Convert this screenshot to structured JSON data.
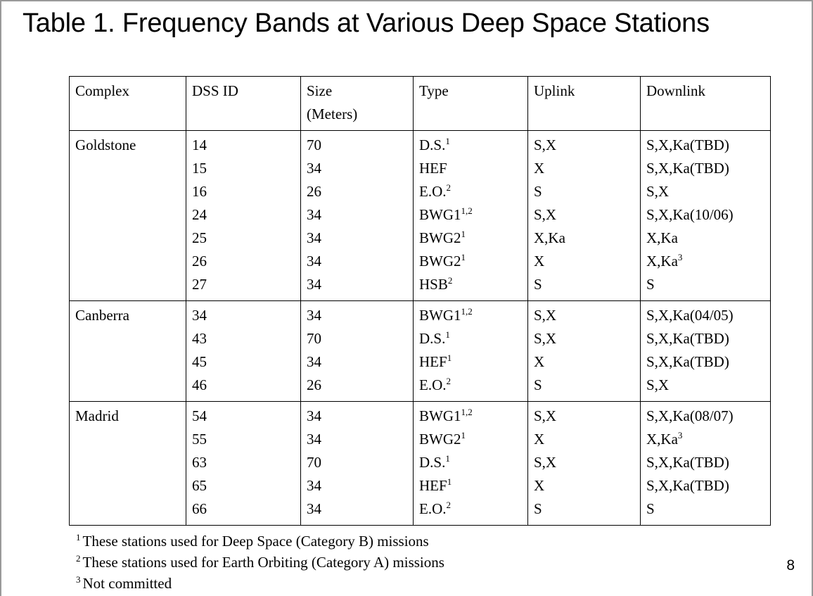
{
  "slide": {
    "title": "Table 1. Frequency Bands at Various Deep Space Stations",
    "page_number": "8",
    "border_color": "#9a9a9a",
    "text_color": "#000000",
    "background_color": "#ffffff"
  },
  "table": {
    "headers": {
      "complex": "Complex",
      "dss_id": "DSS ID",
      "size_line1": "Size",
      "size_line2": "(Meters)",
      "type": "Type",
      "uplink": "Uplink",
      "downlink": "Downlink"
    },
    "groups": [
      {
        "complex": "Goldstone",
        "rows": [
          {
            "dss_id": "14",
            "size": "70",
            "type": "D.S.",
            "type_sup": "1",
            "uplink": "S,X",
            "downlink": "S,X,Ka(TBD)",
            "downlink_sup": ""
          },
          {
            "dss_id": "15",
            "size": "34",
            "type": "HEF",
            "type_sup": "",
            "uplink": "X",
            "downlink": "S,X,Ka(TBD)",
            "downlink_sup": ""
          },
          {
            "dss_id": "16",
            "size": "26",
            "type": "E.O.",
            "type_sup": "2",
            "uplink": "S",
            "downlink": "S,X",
            "downlink_sup": ""
          },
          {
            "dss_id": "24",
            "size": "34",
            "type": "BWG1",
            "type_sup": "1,2",
            "uplink": "S,X",
            "downlink": "S,X,Ka(10/06)",
            "downlink_sup": ""
          },
          {
            "dss_id": "25",
            "size": "34",
            "type": "BWG2",
            "type_sup": "1",
            "uplink": "X,Ka",
            "downlink": "X,Ka",
            "downlink_sup": ""
          },
          {
            "dss_id": "26",
            "size": "34",
            "type": "BWG2",
            "type_sup": "1",
            "uplink": "X",
            "downlink": "X,Ka",
            "downlink_sup": "3"
          },
          {
            "dss_id": "27",
            "size": "34",
            "type": "HSB",
            "type_sup": "2",
            "uplink": "S",
            "downlink": "S",
            "downlink_sup": ""
          }
        ]
      },
      {
        "complex": "Canberra",
        "rows": [
          {
            "dss_id": "34",
            "size": "34",
            "type": "BWG1",
            "type_sup": "1,2",
            "uplink": "S,X",
            "downlink": "S,X,Ka(04/05)",
            "downlink_sup": ""
          },
          {
            "dss_id": "43",
            "size": "70",
            "type": "D.S.",
            "type_sup": "1",
            "uplink": "S,X",
            "downlink": "S,X,Ka(TBD)",
            "downlink_sup": ""
          },
          {
            "dss_id": "45",
            "size": "34",
            "type": "HEF",
            "type_sup": "1",
            "uplink": "X",
            "downlink": "S,X,Ka(TBD)",
            "downlink_sup": ""
          },
          {
            "dss_id": "46",
            "size": "26",
            "type": "E.O.",
            "type_sup": "2",
            "uplink": "S",
            "downlink": "S,X",
            "downlink_sup": ""
          }
        ]
      },
      {
        "complex": "Madrid",
        "rows": [
          {
            "dss_id": "54",
            "size": "34",
            "type": "BWG1",
            "type_sup": "1,2",
            "uplink": "S,X",
            "downlink": "S,X,Ka(08/07)",
            "downlink_sup": ""
          },
          {
            "dss_id": "55",
            "size": "34",
            "type": "BWG2",
            "type_sup": "1",
            "uplink": "X",
            "downlink": "X,Ka",
            "downlink_sup": "3"
          },
          {
            "dss_id": "63",
            "size": "70",
            "type": "D.S.",
            "type_sup": "1",
            "uplink": "S,X",
            "downlink": "S,X,Ka(TBD)",
            "downlink_sup": ""
          },
          {
            "dss_id": "65",
            "size": "34",
            "type": "HEF",
            "type_sup": "1",
            "uplink": "X",
            "downlink": "S,X,Ka(TBD)",
            "downlink_sup": ""
          },
          {
            "dss_id": "66",
            "size": "34",
            "type": "E.O.",
            "type_sup": "2",
            "uplink": "S",
            "downlink": "S",
            "downlink_sup": ""
          }
        ]
      }
    ]
  },
  "footnotes": [
    {
      "marker": "1",
      "text": "These stations used for Deep Space (Category B) missions"
    },
    {
      "marker": "2",
      "text": "These stations used for Earth Orbiting (Category A) missions"
    },
    {
      "marker": "3",
      "text": "Not committed"
    }
  ]
}
